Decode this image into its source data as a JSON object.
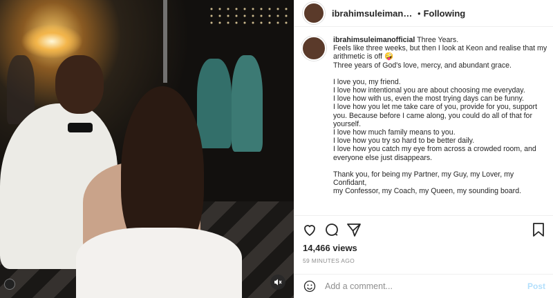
{
  "media": {
    "mute_icon": "muted-speaker-icon"
  },
  "header": {
    "username": "ibrahimsuleimanofficial",
    "separator": "•",
    "follow_status": "Following"
  },
  "caption": {
    "username": "ibrahimsuleimanofficial",
    "lines": [
      "Three Years.",
      "Feels like three weeks, but then I look at Keon and realise that my",
      "arithmetic is off 🤪",
      "Three years of God's love, mercy, and abundant grace.",
      "",
      "I love you, my friend.",
      "I love how intentional you are about choosing me everyday.",
      "I love how with us, even the most trying days can be funny.",
      "I love how you let me take care of you, provide for you, support",
      "you. Because before I came along, you could do all of that for",
      "yourself.",
      "I love how much family means to you.",
      "I love how you try so hard to be better daily.",
      "I love how you catch my eye from across a crowded room, and",
      "everyone else just disappears.",
      "",
      "Thank you, for being my Partner, my Guy, my Lover, my Confidant,",
      "my Confessor, my Coach, my Queen, my sounding board."
    ]
  },
  "stats": {
    "views": "14,466 views",
    "time": "59 MINUTES AGO"
  },
  "comment": {
    "placeholder": "Add a comment...",
    "post_label": "Post"
  },
  "icons": {
    "like": "heart-icon",
    "comment": "comment-icon",
    "share": "share-icon",
    "save": "bookmark-icon",
    "emoji": "emoji-icon"
  }
}
